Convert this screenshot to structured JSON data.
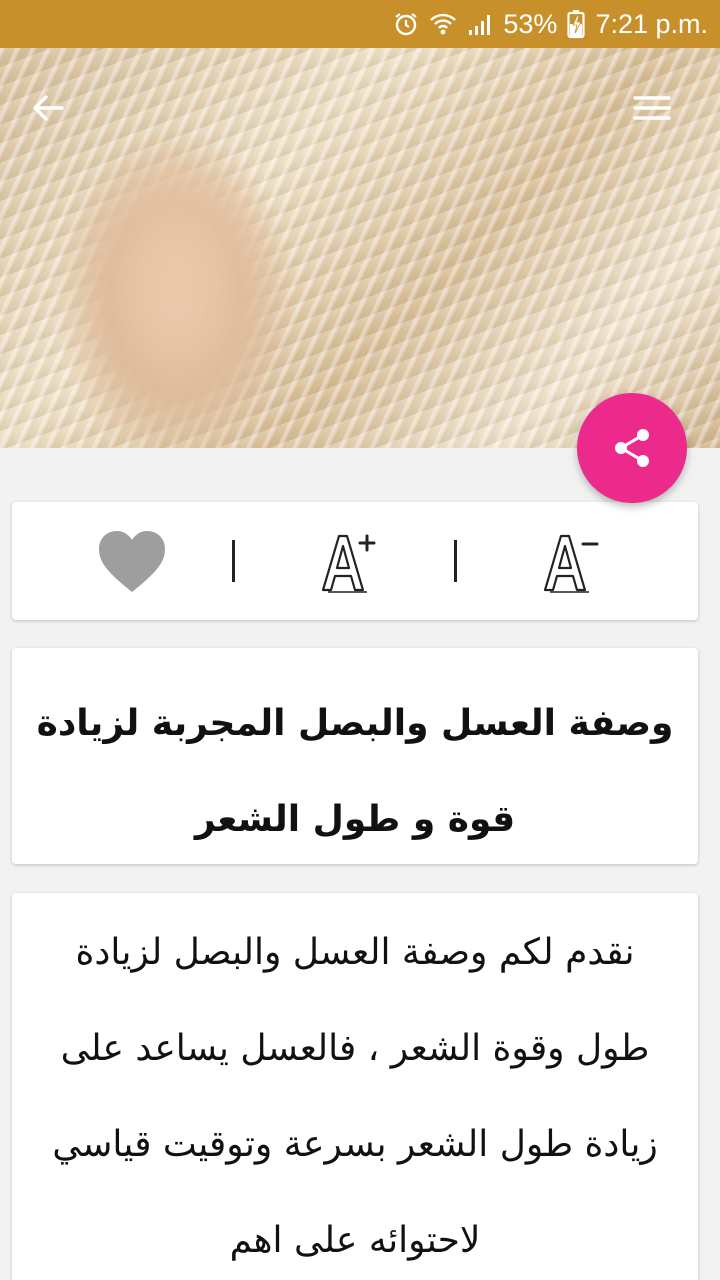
{
  "status_bar": {
    "battery_percent": "53%",
    "time": "7:21 p.m.",
    "icons": [
      "alarm-icon",
      "wifi-icon",
      "signal-icon",
      "battery-charging-icon"
    ]
  },
  "header": {
    "back_icon": "arrow-left-icon",
    "menu_icon": "hamburger-menu-icon"
  },
  "fab": {
    "icon": "share-icon",
    "color": "#ec2a8c"
  },
  "toolbar": {
    "favorite_icon": "heart-icon",
    "font_increase_label": "A+",
    "font_decrease_label": "A-"
  },
  "article": {
    "title": "وصفة العسل والبصل المجربة لزيادة قوة و طول الشعر",
    "body": "نقدم لكم وصفة العسل والبصل لزيادة طول وقوة الشعر ، فالعسل يساعد على زيادة طول الشعر بسرعة وتوقيت قياسي لاحتوائه على اهم"
  },
  "colors": {
    "status_bar": "#c8902a",
    "accent": "#ec2a8c",
    "background": "#f2f2f2"
  }
}
